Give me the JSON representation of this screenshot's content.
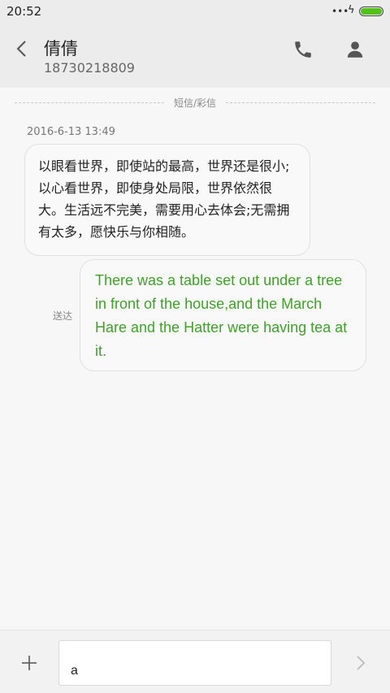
{
  "status_bar": {
    "time": "20:52",
    "more_dots": "•••",
    "charging_symbol": "ϟ",
    "battery_level": 1.0,
    "battery_color": "#55c21a"
  },
  "header": {
    "contact_name": "倩倩",
    "contact_number": "18730218809",
    "icons": [
      "back-chevron-icon",
      "phone-icon",
      "contact-profile-icon"
    ]
  },
  "thread": {
    "channel_label": "短信/彩信",
    "timestamp": "2016-6-13 13:49",
    "incoming_message": "以眼看世界，即使站的最高，世界还是很小;以心看世界，即使身处局限，世界依然很大。生活远不完美，需要用心去体会;无需拥有太多，愿快乐与你相随。",
    "outgoing_message": "There was a table set out under a tree in front of the house,and the March Hare and the Hatter were having tea at it.",
    "outgoing_status": "送达",
    "outgoing_text_color": "#3fa12a"
  },
  "composer": {
    "input_value": "a",
    "icons": [
      "add-icon",
      "send-icon"
    ]
  }
}
